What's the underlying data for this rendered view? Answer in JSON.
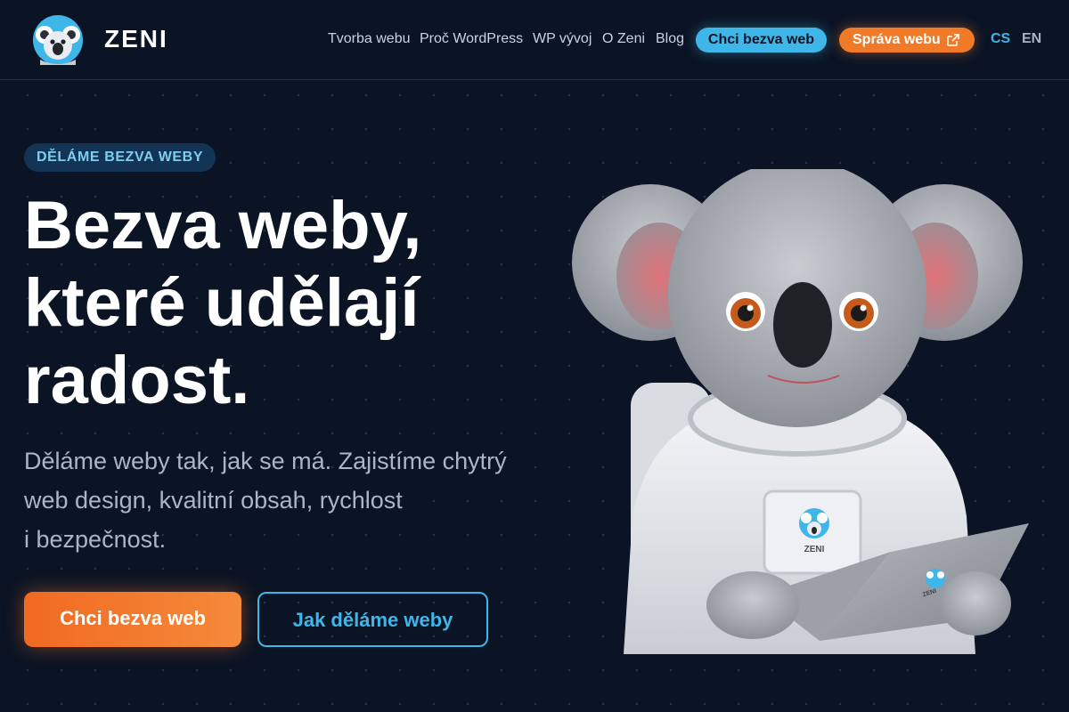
{
  "brand": {
    "name": "ZENI",
    "logo_icon": "koala-logo-icon"
  },
  "nav": {
    "links": [
      "Tvorba webu",
      "Proč WordPress",
      "WP vývoj",
      "O Zeni",
      "Blog"
    ],
    "cta_primary": "Chci bezva web",
    "cta_secondary": "Správa webu",
    "cta_secondary_icon": "external-link-icon",
    "languages": [
      "CS",
      "EN"
    ],
    "active_language": "CS"
  },
  "hero": {
    "eyebrow": "DĚLÁME BEZVA WEBY",
    "headline_lines": [
      "Bezva weby,",
      "které udělají",
      "radost."
    ],
    "lead_lines": [
      "Děláme weby tak, jak se má. Zajistíme chytrý",
      "web design, kvalitní obsah, rychlost",
      "i bezpečnost."
    ],
    "button_primary": "Chci bezva web",
    "button_secondary": "Jak děláme weby",
    "illustration": "koala-astronaut-with-laptop",
    "suit_badge_text": "ZENI",
    "laptop_badge_text": "ZENI"
  },
  "colors": {
    "background": "#0b1424",
    "accent_blue": "#3fb6e8",
    "accent_orange": "#f07a27",
    "text_muted": "#aab6c8"
  }
}
